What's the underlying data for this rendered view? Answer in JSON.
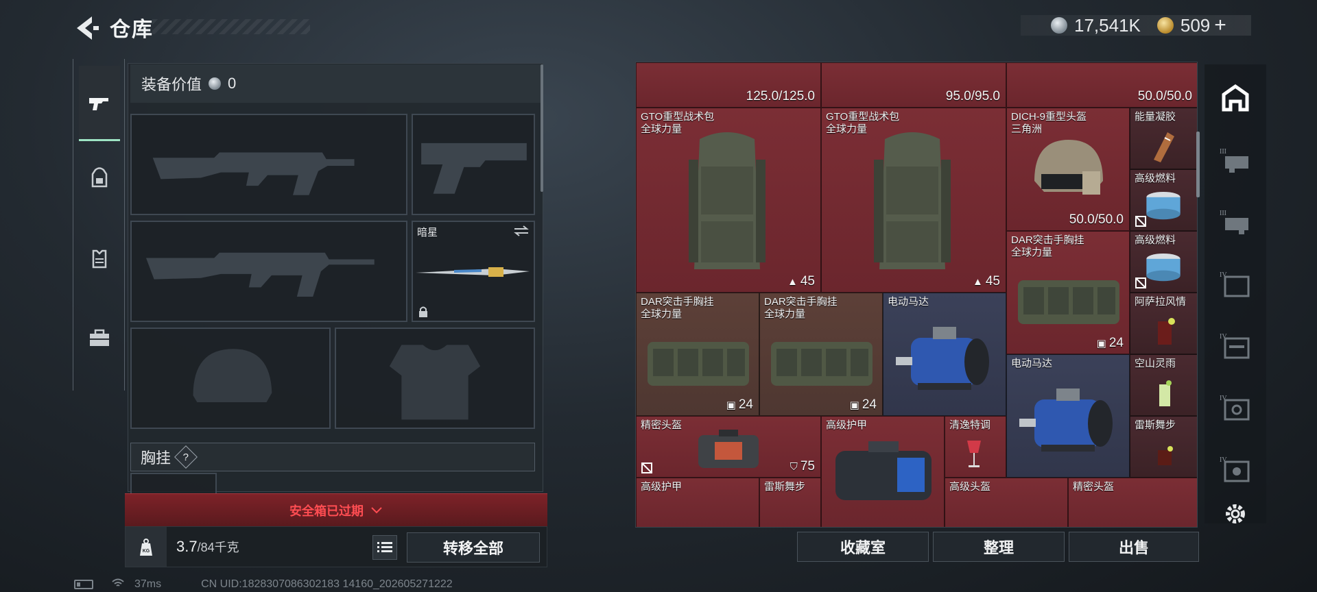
{
  "header": {
    "title": "仓库",
    "silver": "17,541K",
    "gold": "509",
    "gold_plus": "+"
  },
  "side_tabs": [
    {
      "id": "weapons",
      "icon": "pistol-icon",
      "active": true
    },
    {
      "id": "backpack",
      "icon": "backpack-icon",
      "active": false
    },
    {
      "id": "vest",
      "icon": "vest-icon",
      "active": false
    },
    {
      "id": "toolbox",
      "icon": "toolbox-icon",
      "active": false
    }
  ],
  "loadout": {
    "equip_value_label": "装备价值",
    "equip_value": "0",
    "knife_name": "暗星",
    "chest_label": "胸挂",
    "help": "?",
    "expired_text": "安全箱已过期",
    "weight_current": "3.7",
    "weight_max": "/84千克",
    "transfer_all": "转移全部"
  },
  "storage": {
    "top_row_values": [
      "125.0/125.0",
      "95.0/95.0",
      "50.0/50.0"
    ],
    "items": [
      {
        "name": "GTO重型战术包",
        "sub": "全球力量",
        "value": "45",
        "badge": "backpack-badge"
      },
      {
        "name": "GTO重型战术包",
        "sub": "全球力量",
        "value": "45",
        "badge": "backpack-badge"
      },
      {
        "name": "DICH-9重型头盔",
        "sub": "三角洲",
        "value": "50.0/50.0"
      },
      {
        "name": "能量凝胶"
      },
      {
        "name": "高级燃料"
      },
      {
        "name": "DAR突击手胸挂",
        "sub": "全球力量",
        "value": "24",
        "badge": "vest-badge"
      },
      {
        "name": "高级燃料"
      },
      {
        "name": "DAR突击手胸挂",
        "sub": "全球力量",
        "value": "24",
        "badge": "vest-badge"
      },
      {
        "name": "DAR突击手胸挂",
        "sub": "全球力量",
        "value": "24",
        "badge": "vest-badge"
      },
      {
        "name": "电动马达"
      },
      {
        "name": "阿萨拉风情"
      },
      {
        "name": "电动马达"
      },
      {
        "name": "空山灵雨"
      },
      {
        "name": "精密头盔",
        "value": "75",
        "badge": "shield-badge"
      },
      {
        "name": "高级护甲"
      },
      {
        "name": "清逸特调"
      },
      {
        "name": "雷斯舞步"
      },
      {
        "name": "高级护甲"
      },
      {
        "name": "雷斯舞步"
      },
      {
        "name": "高级头盔"
      },
      {
        "name": "精密头盔"
      }
    ]
  },
  "actions": {
    "collection": "收藏室",
    "sort": "整理",
    "sell": "出售"
  },
  "categories": [
    {
      "icon": "home-icon",
      "tier": ""
    },
    {
      "icon": "helmet-category-icon",
      "tier": "III"
    },
    {
      "icon": "armor-category-icon",
      "tier": "III"
    },
    {
      "icon": "backpack-category-icon",
      "tier": "IV"
    },
    {
      "icon": "vest-category-icon",
      "tier": "IV"
    },
    {
      "icon": "safe-category-icon",
      "tier": "IV"
    },
    {
      "icon": "case-category-icon",
      "tier": "IV"
    },
    {
      "icon": "settings-icon",
      "tier": ""
    }
  ],
  "status": {
    "ping": "37ms",
    "uid": "CN UID:1828307086302183 14160_202605271222"
  },
  "colors": {
    "accent": "#9ee4c4",
    "warning": "#ff4d52",
    "storage_red": "#7b2e35"
  }
}
